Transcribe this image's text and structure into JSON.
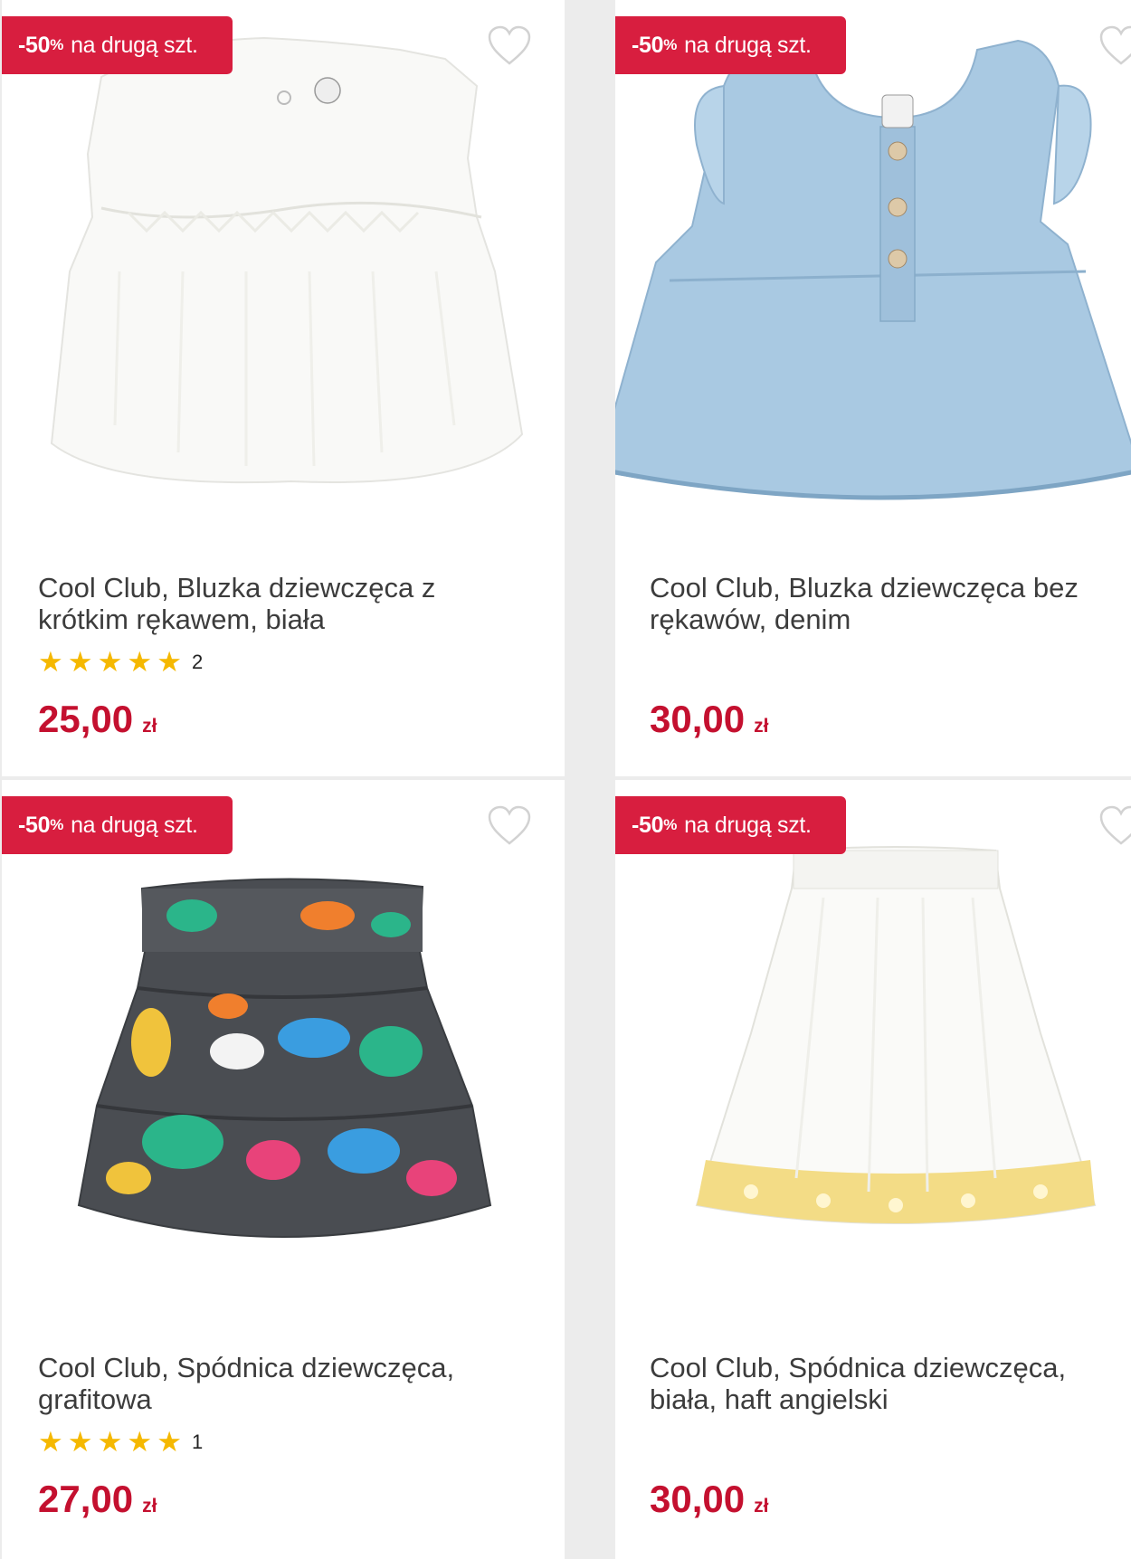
{
  "products": [
    {
      "badge_percent": "-50",
      "badge_pct_sign": "%",
      "badge_text": "na drugą szt.",
      "title_line1": "Cool Club, Bluzka dziewczęca z",
      "title_line2": "krótkim rękawem, biała",
      "stars": 5,
      "rating_count": "2",
      "price_value": "25,00",
      "price_currency": "zł",
      "image": "white-ruffle-blouse"
    },
    {
      "badge_percent": "-50",
      "badge_pct_sign": "%",
      "badge_text": "na drugą szt.",
      "title_line1": "Cool Club, Bluzka dziewczęca bez",
      "title_line2": "rękawów, denim",
      "price_value": "30,00",
      "price_currency": "zł",
      "image": "denim-sleeveless-blouse"
    },
    {
      "badge_percent": "-50",
      "badge_pct_sign": "%",
      "badge_text": "na drugą szt.",
      "title_line1": "Cool Club, Spódnica dziewczęca,",
      "title_line2": "grafitowa",
      "stars": 5,
      "rating_count": "1",
      "price_value": "27,00",
      "price_currency": "zł",
      "image": "graphite-floral-tiered-skirt"
    },
    {
      "badge_percent": "-50",
      "badge_pct_sign": "%",
      "badge_text": "na drugą szt.",
      "title_line1": "Cool Club, Spódnica dziewczęca,",
      "title_line2": "biała, haft angielski",
      "price_value": "30,00",
      "price_currency": "zł",
      "image": "white-skirt-yellow-embroidery"
    }
  ],
  "colors": {
    "badge": "#d81e3f",
    "price": "#c4102f",
    "star": "#f5b800"
  },
  "icons": {
    "wishlist": "heart-outline-icon",
    "rating": "star-icon"
  }
}
